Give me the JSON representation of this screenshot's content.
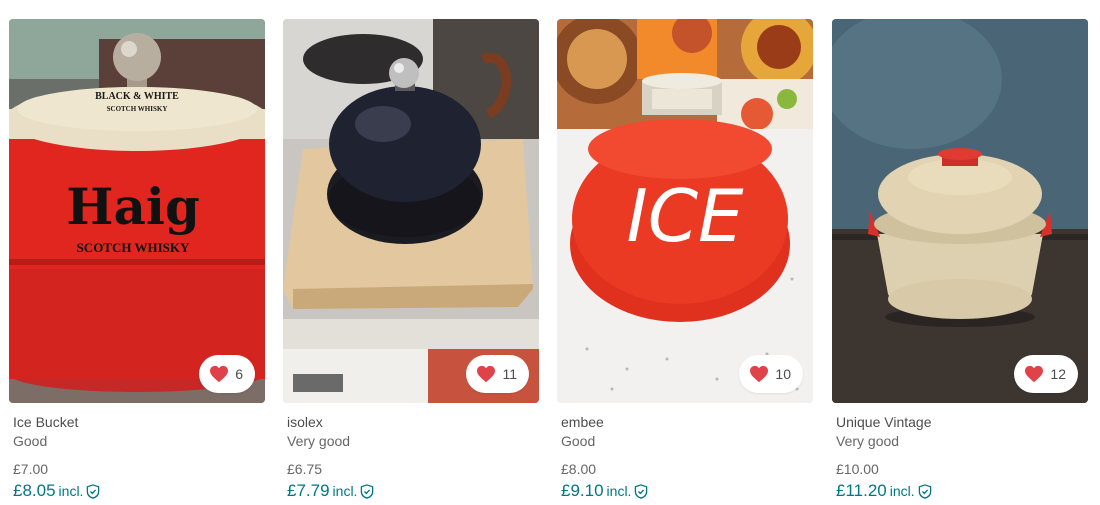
{
  "items": [
    {
      "title": "Ice Bucket",
      "condition": "Good",
      "price": "£7.00",
      "price_incl": "£8.05",
      "incl_label": "incl.",
      "favourites": "6",
      "photo_text": {
        "top": "BLACK & WHITE",
        "sub": "SCOTCH WHISKY",
        "brand": "Haig",
        "brand_sub": "SCOTCH WHISKY"
      }
    },
    {
      "title": "isolex",
      "condition": "Very good",
      "price": "£6.75",
      "price_incl": "£7.79",
      "incl_label": "incl.",
      "favourites": "11"
    },
    {
      "title": "embee",
      "condition": "Good",
      "price": "£8.00",
      "price_incl": "£9.10",
      "incl_label": "incl.",
      "favourites": "10",
      "photo_text": {
        "brand": "ICE"
      }
    },
    {
      "title": "Unique Vintage",
      "condition": "Very good",
      "price": "£10.00",
      "price_incl": "£11.20",
      "incl_label": "incl.",
      "favourites": "12"
    }
  ],
  "colors": {
    "accent": "#007782",
    "heart": "#e0424a"
  },
  "icons": {
    "favourite": "heart-icon",
    "protection": "shield-icon"
  }
}
